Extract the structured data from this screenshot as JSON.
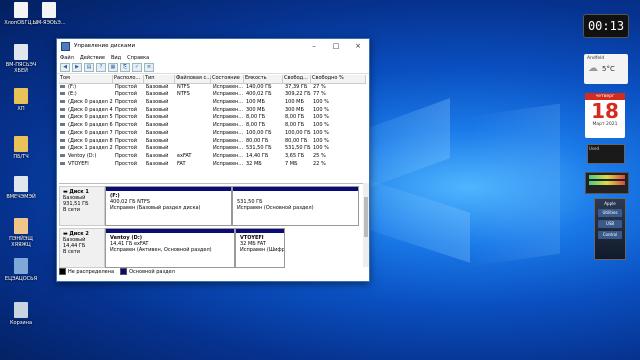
{
  "desktop": {
    "icons": [
      {
        "label": "ХлопОБГЦ....",
        "icon": "doc-icon"
      },
      {
        "label": "ЫМ-ЯЭОЬЭ...",
        "icon": "doc-icon"
      },
      {
        "label": "ВМ-ПЯСЬЭЧ ХБЕЙ",
        "icon": "file-icon"
      },
      {
        "label": "ХП",
        "icon": "folder-icon"
      },
      {
        "label": "ПБ/ТЧ",
        "icon": "folder-icon"
      },
      {
        "label": "ВМЕЧЭМЭЙ",
        "icon": "file-icon"
      },
      {
        "label": "ПЭНЙЭЩ ХЯЯЖЦ",
        "icon": "user-icon"
      },
      {
        "label": "ЕЦЭАЦОСЬЯ",
        "icon": "computer-icon"
      },
      {
        "label": "Корзина",
        "icon": "recycle-bin-icon"
      }
    ]
  },
  "window": {
    "title": "Управление дисками",
    "menu": [
      "Файл",
      "Действие",
      "Вид",
      "Справка"
    ],
    "columns": [
      "Том",
      "Располо...",
      "Тип",
      "Файловая с...",
      "Состояние",
      "Емкость",
      "Свобод...",
      "Свободно %"
    ],
    "volumes": [
      [
        "(F:)",
        "Простой",
        "Базовый",
        "NTFS",
        "Исправен...",
        "140,00 ГБ",
        "37,39 ГБ",
        "27 %"
      ],
      [
        "(E:)",
        "Простой",
        "Базовый",
        "NTFS",
        "Исправен...",
        "400,02 ГБ",
        "309,22 ГБ",
        "77 %"
      ],
      [
        "(Диск 0 раздел 2)",
        "Простой",
        "Базовый",
        "",
        "Исправен...",
        "100 МБ",
        "100 МБ",
        "100 %"
      ],
      [
        "(Диск 0 раздел 4)",
        "Простой",
        "Базовый",
        "",
        "Исправен...",
        "300 МБ",
        "300 МБ",
        "100 %"
      ],
      [
        "(Диск 0 раздел 5)",
        "Простой",
        "Базовый",
        "",
        "Исправен...",
        "8,00 ГБ",
        "8,00 ГБ",
        "100 %"
      ],
      [
        "(Диск 0 раздел 6)",
        "Простой",
        "Базовый",
        "",
        "Исправен...",
        "8,00 ГБ",
        "8,00 ГБ",
        "100 %"
      ],
      [
        "(Диск 0 раздел 7)",
        "Простой",
        "Базовый",
        "",
        "Исправен...",
        "100,00 ГБ",
        "100,00 ГБ",
        "100 %"
      ],
      [
        "(Диск 0 раздел 8)",
        "Простой",
        "Базовый",
        "",
        "Исправен...",
        "80,00 ГБ",
        "80,00 ГБ",
        "100 %"
      ],
      [
        "(Диск 1 раздел 2)",
        "Простой",
        "Базовый",
        "",
        "Исправен...",
        "531,50 ГБ",
        "531,50 ГБ",
        "100 %"
      ],
      [
        "Ventoy (D:)",
        "Простой",
        "Базовый",
        "exFAT",
        "Исправен...",
        "14,40 ГБ",
        "3,65 ГБ",
        "25 %"
      ],
      [
        "VTOYEFI",
        "Простой",
        "Базовый",
        "FAT",
        "Исправен...",
        "32 МБ",
        "7 МБ",
        "22 %"
      ]
    ],
    "disks": [
      {
        "name": "Диск 1",
        "type": "Базовый",
        "size": "931,51 ГБ",
        "status": "В сети",
        "partitions": [
          {
            "name": "(F:)",
            "detail": "400,02 ГБ NTFS",
            "state": "Исправен (Базовый раздел диска)"
          },
          {
            "name": "",
            "detail": "531,50 ГБ",
            "state": "Исправен (Основной раздел)"
          }
        ]
      },
      {
        "name": "Диск 2",
        "type": "Базовый",
        "size": "14,44 ГБ",
        "status": "В сети",
        "partitions": [
          {
            "name": "Ventoy  (D:)",
            "detail": "14,41 ГБ exFAT",
            "state": "Исправен (Активен, Основной раздел)"
          },
          {
            "name": "VTOYEFI",
            "detail": "32 МБ FAT",
            "state": "Исправен (Шифрс"
          }
        ]
      }
    ],
    "legend": [
      "Не распределена",
      "Основной раздел"
    ],
    "legend_colors": [
      "#000000",
      "#0a0a78"
    ]
  },
  "widgets": {
    "clock": "00:13",
    "weather_city": "Andfeld",
    "weather_temp": "5°C",
    "cal_weekday": "четверг",
    "cal_day": "18",
    "cal_month": "Март 2021",
    "cpu_label": "Used",
    "panel_title": "Apple",
    "panel_buttons": [
      "Utilities",
      "USB",
      "Control"
    ]
  }
}
